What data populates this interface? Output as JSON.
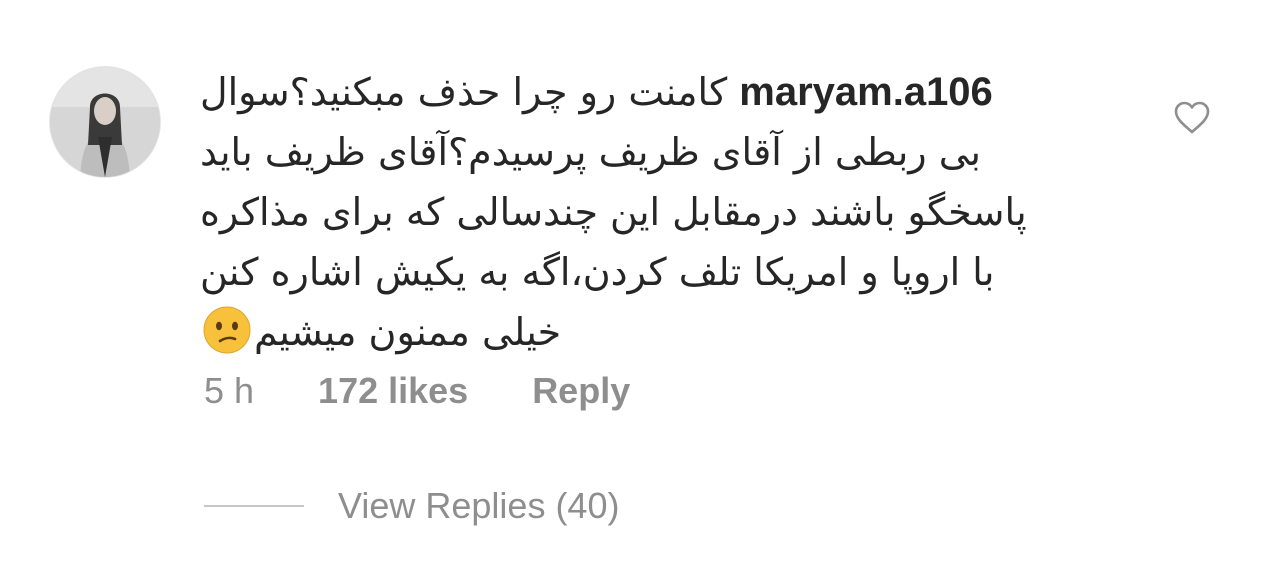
{
  "comment": {
    "username": "maryam.a106",
    "lines": [
      "کامنت رو چرا حذف مبکنید؟سوال",
      "بی ربطی از آقای ظریف پرسیدم؟آقای ظریف باید",
      "پاسخگو باشند درمقابل این چندسالی که برای مذاکره",
      "با اروپا و امریکا تلف کردن،اگه به یکیش اشاره کنن",
      "خیلی ممنون میشیم"
    ],
    "emoji": "confused-face-emoji"
  },
  "meta": {
    "time": "5 h",
    "likes": "172 likes",
    "reply_label": "Reply"
  },
  "replies": {
    "label": "View Replies (40)"
  },
  "icons": {
    "like": "heart-outline-icon",
    "avatar": "profile-photo"
  },
  "colors": {
    "text": "#262626",
    "muted": "#8e8e8e",
    "divider": "#c7c7c7",
    "emoji_face": "#f7c13b"
  }
}
